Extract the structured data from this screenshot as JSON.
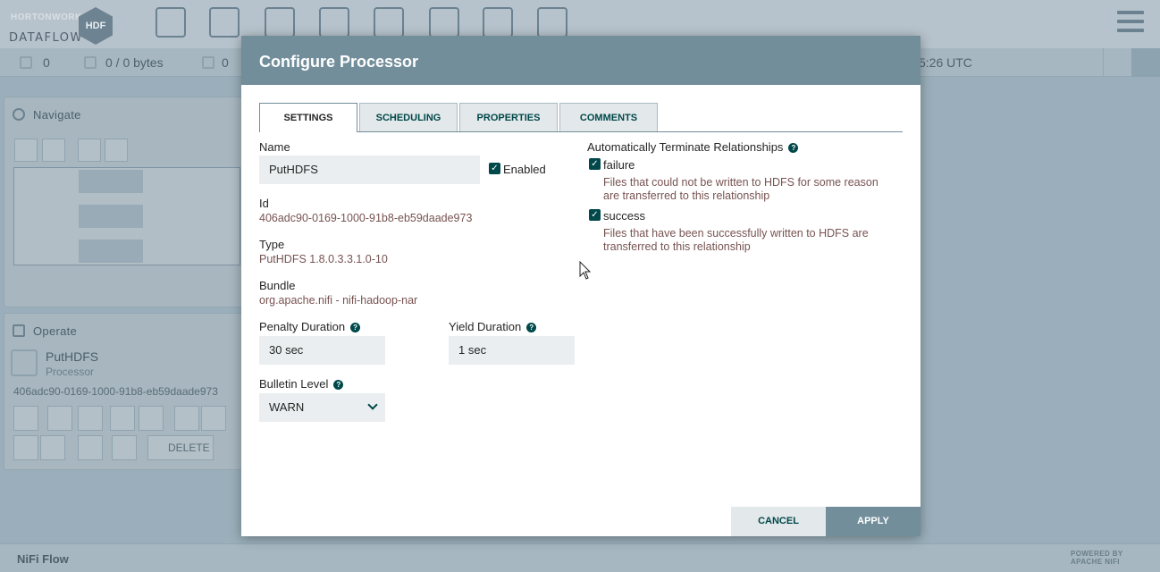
{
  "brand": {
    "company": "HORTONWORKS",
    "product": "DATAFLOW",
    "badge": "HDF"
  },
  "toolbar": {
    "icons": [
      "processor-icon",
      "input-port-icon",
      "output-port-icon",
      "process-group-icon",
      "remote-process-group-icon",
      "funnel-icon",
      "template-icon",
      "label-icon"
    ]
  },
  "status": {
    "threads": "0",
    "queued": "0 / 0 bytes",
    "transmitting": "0",
    "time": "5:26 UTC"
  },
  "navigate": {
    "title": "Navigate"
  },
  "operate": {
    "title": "Operate",
    "component_name": "PutHDFS",
    "component_type": "Processor",
    "component_id": "406adc90-0169-1000-91b8-eb59daade973",
    "delete_label": "DELETE"
  },
  "footer": {
    "flow_name": "NiFi Flow",
    "powered_line1": "POWERED BY",
    "powered_line2": "APACHE NIFI"
  },
  "dialog": {
    "title": "Configure Processor",
    "tabs": [
      {
        "label": "SETTINGS",
        "active": true
      },
      {
        "label": "SCHEDULING",
        "active": false
      },
      {
        "label": "PROPERTIES",
        "active": false
      },
      {
        "label": "COMMENTS",
        "active": false
      }
    ],
    "settings": {
      "name_label": "Name",
      "name_value": "PutHDFS",
      "enabled_label": "Enabled",
      "enabled": true,
      "id_label": "Id",
      "id_value": "406adc90-0169-1000-91b8-eb59daade973",
      "type_label": "Type",
      "type_value": "PutHDFS 1.8.0.3.3.1.0-10",
      "bundle_label": "Bundle",
      "bundle_value": "org.apache.nifi - nifi-hadoop-nar",
      "penalty_label": "Penalty Duration",
      "penalty_value": "30 sec",
      "yield_label": "Yield Duration",
      "yield_value": "1 sec",
      "bulletin_label": "Bulletin Level",
      "bulletin_value": "WARN"
    },
    "relationships": {
      "title": "Automatically Terminate Relationships",
      "items": [
        {
          "name": "failure",
          "checked": true,
          "description": "Files that could not be written to HDFS for some reason are transferred to this relationship"
        },
        {
          "name": "success",
          "checked": true,
          "description": "Files that have been successfully written to HDFS are transferred to this relationship"
        }
      ]
    },
    "cancel_label": "CANCEL",
    "apply_label": "APPLY"
  },
  "colors": {
    "header": "#728e9b",
    "accent": "#004849",
    "value_text": "#775351",
    "overlay": "#9aafbb"
  }
}
